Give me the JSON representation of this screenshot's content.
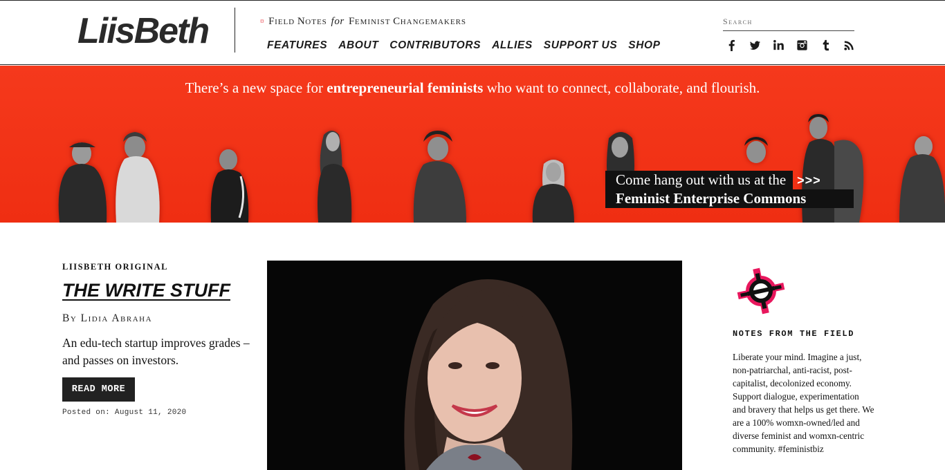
{
  "site": {
    "logo": "LiisBeth",
    "tagline": {
      "part1_first": "F",
      "part1_rest": "ield ",
      "part2_first": "N",
      "part2_rest": "otes ",
      "for": "for",
      "part3_first": "F",
      "part3_rest": "eminist ",
      "part4_first": "C",
      "part4_rest": "hangemakers"
    }
  },
  "nav": {
    "items": [
      "FEATURES",
      "ABOUT",
      "CONTRIBUTORS",
      "ALLIES",
      "SUPPORT US",
      "SHOP"
    ]
  },
  "search": {
    "placeholder": "Search"
  },
  "social": {
    "facebook": "f",
    "twitter": "t",
    "linkedin": "in",
    "instagram": "◘",
    "tumblr": "t",
    "rss": "rss"
  },
  "banner": {
    "headline_pre": "There’s a new space for ",
    "headline_bold": "entrepreneurial feminists",
    "headline_post": " who want to connect, collaborate, and flourish.",
    "cta_line1": "Come hang out with us at the",
    "cta_arrow": ">>>",
    "cta_line2": "Feminist Enterprise Commons",
    "colors": {
      "background": "#f23a1e",
      "cta_box": "#111111"
    }
  },
  "article": {
    "kicker": "LIISBETH ORIGINAL",
    "title": "THE WRITE STUFF",
    "byline": "By Lidia Abraha",
    "excerpt": "An edu-tech startup improves grades – and passes on investors.",
    "read_more": "READ MORE",
    "posted": "Posted on: August 11, 2020"
  },
  "sidebar": {
    "notes_title": "NOTES FROM THE FIELD",
    "notes_body": "Liberate your mind. Imagine a just, non-patriarchal, anti-racist, post-capitalist, decolonized economy. Support dialogue, experimentation and bravery that helps us get there. We are a 100% womxn-owned/led and diverse feminist and womxn-centric community. #feministbiz",
    "icon_color": "#e8175d"
  }
}
